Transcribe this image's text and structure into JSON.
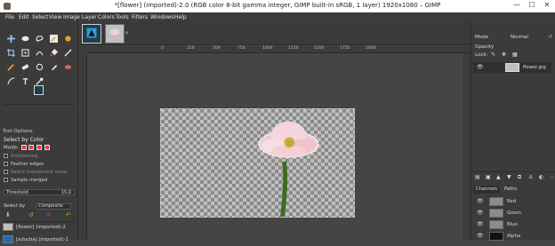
{
  "window": {
    "title": "*[flower] (imported)-2.0 (RGB color 8-bit gamma integer, GIMP built-in sRGB, 1 layer) 1920x1080 – GIMP",
    "minimize": "—",
    "maximize": "☐",
    "close": "✕"
  },
  "menubar": [
    "File",
    "Edit",
    "Select",
    "View",
    "Image",
    "Layer",
    "Colors",
    "Tools",
    "Filters",
    "Windows",
    "Help"
  ],
  "colors": {
    "foreground": "#1f3e49",
    "background": "#ffffff"
  },
  "tool_options": {
    "tabs": "Tool Options",
    "title": "Select by Color",
    "mode_label": "Mode:",
    "checks": [
      {
        "label": "Antialiasing",
        "checked": true,
        "disabled": true
      },
      {
        "label": "Feather edges",
        "checked": false,
        "disabled": false
      },
      {
        "label": "Select transparent areas",
        "checked": true,
        "disabled": true
      },
      {
        "label": "Sample merged",
        "checked": false,
        "disabled": false
      }
    ],
    "threshold_label": "Threshold",
    "threshold_value": "15.0",
    "select_by_label": "Select by",
    "select_by_value": "Composite"
  },
  "images": [
    {
      "name": "[flower] (imported)-2"
    },
    {
      "name": "[educba] (imported)-1"
    }
  ],
  "rulers": {
    "h_ticks": [
      "0",
      "250",
      "500",
      "750",
      "1000",
      "1250",
      "1500",
      "1750",
      "2000"
    ]
  },
  "layers_panel": {
    "mode_label": "Mode",
    "mode_value": "Normal",
    "opacity_label": "Opacity",
    "lock_label": "Lock:",
    "layers": [
      {
        "name": "flower.jpg"
      }
    ]
  },
  "channels_panel": {
    "tabs": [
      "Channels",
      "Paths"
    ],
    "channels": [
      {
        "name": "Red"
      },
      {
        "name": "Green"
      },
      {
        "name": "Blue"
      },
      {
        "name": "Alpha"
      }
    ]
  }
}
